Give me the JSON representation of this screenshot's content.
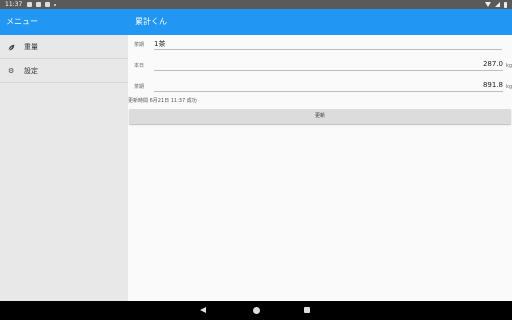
{
  "statusbar": {
    "time": "11:37"
  },
  "drawer": {
    "title": "メニュー",
    "items": [
      {
        "label": "重量",
        "icon": "leaf-icon"
      },
      {
        "label": "設定",
        "icon": "gear-icon"
      }
    ]
  },
  "appbar": {
    "title": "累計くん"
  },
  "form": {
    "tea_label": "茶期",
    "tea_value": "1茶",
    "today_label": "本日",
    "today_value": "287.0",
    "today_unit": "kg",
    "season_label": "茶期",
    "season_value": "891.8",
    "season_unit": "kg",
    "status": "更新時間  6月21日 11:37  成功",
    "update_label": "更新"
  },
  "colors": {
    "primary": "#2196f3",
    "drawer_bg": "#e8e8e8",
    "content_bg": "#fafafa",
    "navbar": "#000000"
  }
}
